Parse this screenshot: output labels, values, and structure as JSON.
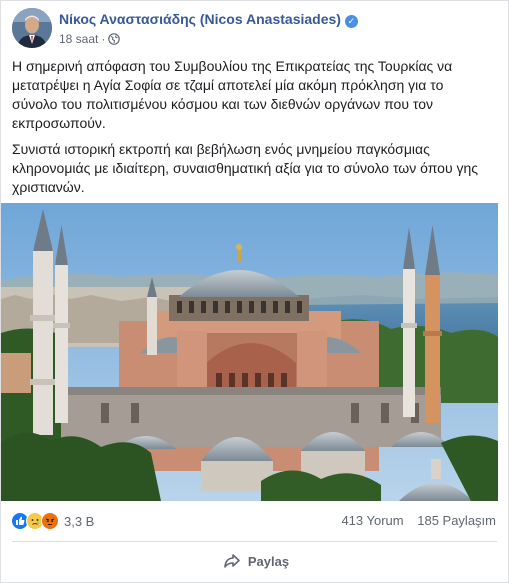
{
  "post": {
    "author": "Νίκος Αναστασιάδης (Nicos Anastasiades)",
    "timestamp": "18 saat",
    "separator": "·",
    "paragraphs": [
      "Η σημερινή απόφαση του Συμβουλίου της Επικρατείας της Τουρκίας να μετατρέψει η Αγία Σοφία σε τζαμί αποτελεί μία ακόμη πρόκληση για το σύνολο του πολιτισμένου κόσμου και των διεθνών οργάνων που τον εκπροσωπούν.",
      "Συνιστά ιστορική εκτροπή και βεβήλωση ενός μνημείου παγκόσμιας κληρονομιάς με ιδιαίτερη, συναισθηματική αξία για το σύνολο των όπου γης χριστιανών."
    ]
  },
  "footer": {
    "reaction_count": "3,3 B",
    "comments": "413 Yorum",
    "shares": "185 Paylaşım",
    "share_label": "Paylaş"
  },
  "icons": [
    "verified-badge-icon",
    "globe-icon",
    "like-reaction-icon",
    "sad-reaction-icon",
    "angry-reaction-icon",
    "share-arrow-icon"
  ],
  "colors": {
    "author_link": "#385898",
    "verified": "#4a90e2",
    "like": "#1877f2",
    "sad": "#f7c948",
    "angry": "#e9710f",
    "secondary_text": "#606770"
  }
}
